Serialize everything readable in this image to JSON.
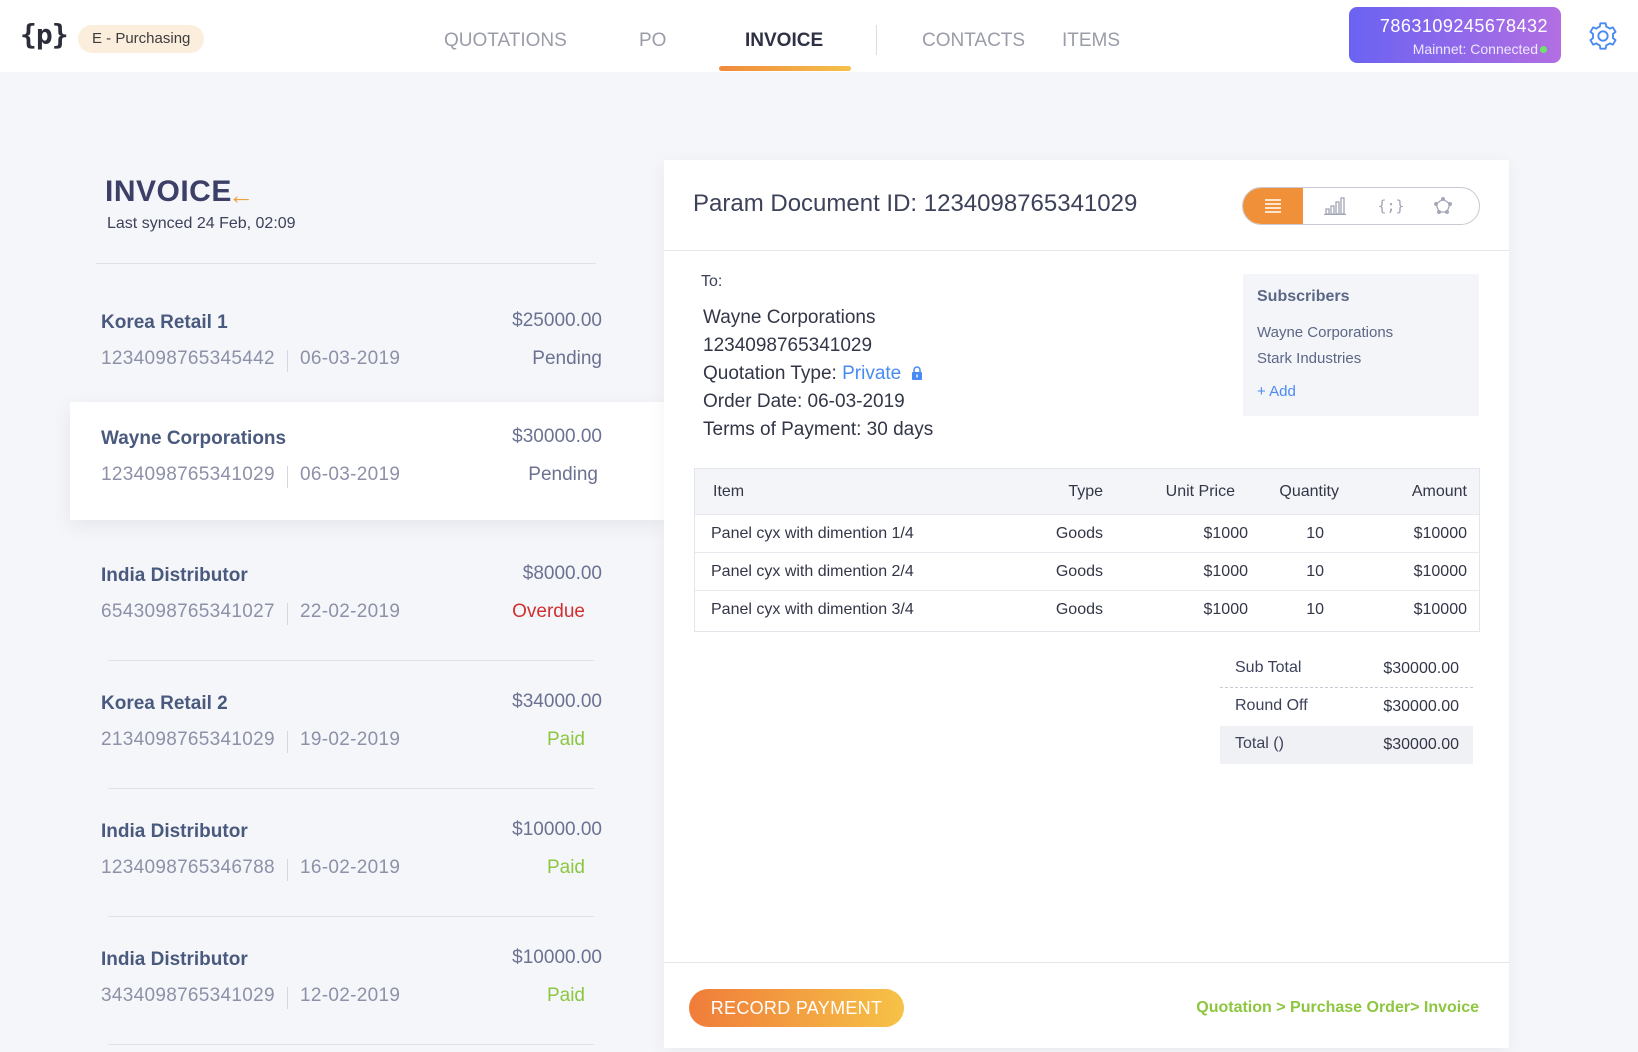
{
  "app": {
    "logo_text": "{p}",
    "module": "E - Purchasing"
  },
  "nav": {
    "tabs": [
      {
        "label": "QUOTATIONS",
        "active": false
      },
      {
        "label": "PO",
        "active": false
      },
      {
        "label": "INVOICE",
        "active": true
      },
      {
        "label": "CONTACTS",
        "active": false
      },
      {
        "label": "ITEMS",
        "active": false
      }
    ]
  },
  "wallet": {
    "id": "7863109245678432",
    "status": "Mainnet: Connected"
  },
  "list": {
    "title": "INVOICE",
    "last_synced": "Last synced 24 Feb, 02:09",
    "items": [
      {
        "name": "Korea Retail 1",
        "amount": "$25000.00",
        "id": "1234098765345442",
        "date": "06-03-2019",
        "status": "Pending"
      },
      {
        "name": "Wayne Corporations",
        "amount": "$30000.00",
        "id": "1234098765341029",
        "date": "06-03-2019",
        "status": "Pending"
      },
      {
        "name": "India Distributor",
        "amount": "$8000.00",
        "id": "6543098765341027",
        "date": "22-02-2019",
        "status": "Overdue"
      },
      {
        "name": "Korea Retail 2",
        "amount": "$34000.00",
        "id": "2134098765341029",
        "date": "19-02-2019",
        "status": "Paid"
      },
      {
        "name": "India Distributor",
        "amount": "$10000.00",
        "id": "1234098765346788",
        "date": "16-02-2019",
        "status": "Paid"
      },
      {
        "name": "India Distributor",
        "amount": "$10000.00",
        "id": "3434098765341029",
        "date": "12-02-2019",
        "status": "Paid"
      }
    ]
  },
  "detail": {
    "doc_id": "Param Document ID: 1234098765341029",
    "to_label": "To:",
    "to_name": "Wayne Corporations",
    "to_id": "1234098765341029",
    "quotation_type_label": "Quotation Type:",
    "quotation_type": "Private",
    "order_date": "Order Date: 06-03-2019",
    "terms": "Terms of Payment: 30 days",
    "subscribers": {
      "title": "Subscribers",
      "items": [
        "Wayne Corporations",
        "Stark Industries"
      ],
      "add_label": "+ Add"
    },
    "table": {
      "headers": {
        "item": "Item",
        "type": "Type",
        "unit_price": "Unit Price",
        "quantity": "Quantity",
        "amount": "Amount"
      },
      "rows": [
        {
          "item": "Panel cyx with dimention 1/4",
          "type": "Goods",
          "unit_price": "$1000",
          "quantity": "10",
          "amount": "$10000"
        },
        {
          "item": "Panel cyx with dimention 2/4",
          "type": "Goods",
          "unit_price": "$1000",
          "quantity": "10",
          "amount": "$10000"
        },
        {
          "item": "Panel cyx with dimention 3/4",
          "type": "Goods",
          "unit_price": "$1000",
          "quantity": "10",
          "amount": "$10000"
        }
      ]
    },
    "totals": {
      "sub_total_label": "Sub Total",
      "sub_total": "$30000.00",
      "round_off_label": "Round Off",
      "round_off": "$30000.00",
      "total_label": "Total ()",
      "total": "$30000.00"
    },
    "record_payment": "RECORD PAYMENT",
    "flow": "Quotation > Purchase Order> Invoice"
  },
  "colors": {
    "accent_orange": "#f0913a",
    "wallet_start": "#6a63f2",
    "wallet_end": "#b36ee2",
    "paid_green": "#8dc63f",
    "overdue_red": "#d0302f",
    "link_blue": "#4a8af4"
  },
  "icons": {
    "back": "arrow-left-icon",
    "settings": "gear-icon",
    "lock": "lock-icon",
    "view_list": "list-view-icon",
    "view_chart": "chart-view-icon",
    "view_code": "code-view-icon",
    "view_network": "network-view-icon"
  }
}
